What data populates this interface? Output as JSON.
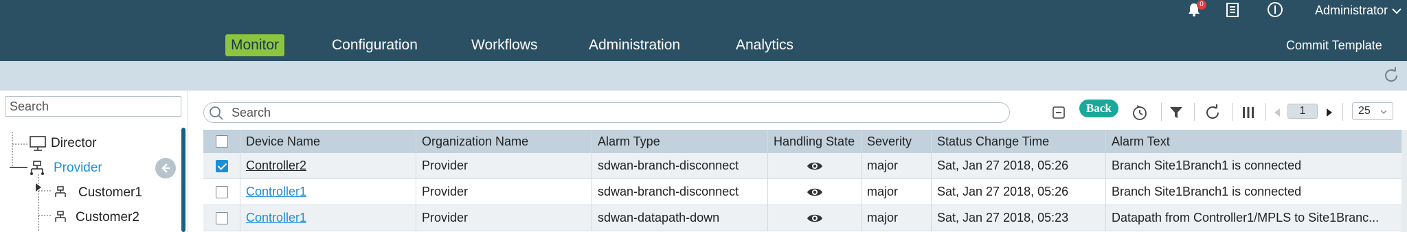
{
  "header": {
    "notifications_badge": "0",
    "user_name": "Administrator",
    "nav_items": [
      {
        "label": "Monitor",
        "active": true
      },
      {
        "label": "Configuration",
        "active": false
      },
      {
        "label": "Workflows",
        "active": false
      },
      {
        "label": "Administration",
        "active": false
      },
      {
        "label": "Analytics",
        "active": false
      }
    ],
    "commit_label": "Commit Template"
  },
  "sidebar": {
    "search_placeholder": "Search",
    "tree": [
      {
        "label": "Director",
        "icon": "director-icon",
        "selected": false
      },
      {
        "label": "Provider",
        "icon": "org-tree-icon",
        "selected": true
      },
      {
        "label": "Customer1",
        "icon": "org-tree-icon",
        "selected": false
      },
      {
        "label": "Customer2",
        "icon": "org-tree-icon",
        "selected": false
      }
    ]
  },
  "toolbar": {
    "search_placeholder": "Search",
    "back_label": "Back",
    "page_number": "1",
    "page_size": "25"
  },
  "grid": {
    "columns": [
      "Device Name",
      "Organization Name",
      "Alarm Type",
      "Handling State",
      "Severity",
      "Status Change Time",
      "Alarm Text"
    ],
    "rows": [
      {
        "checked": true,
        "device": "Controller2",
        "org": "Provider",
        "type": "sdwan-branch-disconnect",
        "severity": "major",
        "time": "Sat, Jan 27 2018, 05:26",
        "text": "Branch Site1Branch1 is connected"
      },
      {
        "checked": false,
        "device": "Controller1",
        "org": "Provider",
        "type": "sdwan-branch-disconnect",
        "severity": "major",
        "time": "Sat, Jan 27 2018, 05:26",
        "text": "Branch Site1Branch1 is connected"
      },
      {
        "checked": false,
        "device": "Controller1",
        "org": "Provider",
        "type": "sdwan-datapath-down",
        "severity": "major",
        "time": "Sat, Jan 27 2018, 05:23",
        "text": "Datapath from Controller1/MPLS to Site1Branc..."
      }
    ]
  },
  "colors": {
    "header_bg": "#2b4f63",
    "nav_active": "#8cc63f",
    "subbar_bg": "#cfdde6",
    "link": "#1b8fd3",
    "back_button": "#1aa89a",
    "grid_head": "#c2d1db"
  }
}
